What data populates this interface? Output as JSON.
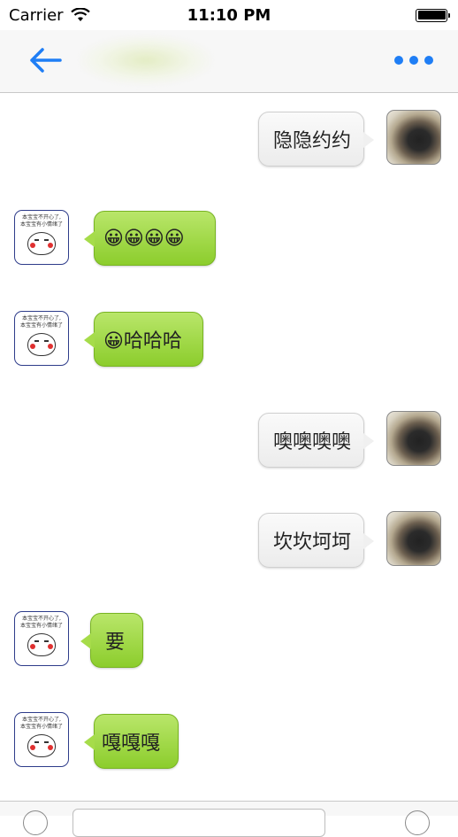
{
  "status_bar": {
    "carrier": "Carrier",
    "time": "11:10 PM"
  },
  "nav": {
    "back_icon": "back-arrow-icon",
    "more_icon": "more-dots-icon",
    "accent_color": "#1f7ef5"
  },
  "messages": [
    {
      "sender": "me",
      "text": "隐隐约约"
    },
    {
      "sender": "other",
      "text": "😀😀😀😀"
    },
    {
      "sender": "other",
      "text": "😀哈哈哈"
    },
    {
      "sender": "me",
      "text": "噢噢噢噢"
    },
    {
      "sender": "me",
      "text": "坎坎坷坷"
    },
    {
      "sender": "other",
      "text": "要"
    },
    {
      "sender": "other",
      "text": "嘎嘎嘎"
    }
  ],
  "avatars": {
    "other_caption_line1": "本宝宝不开心了,",
    "other_caption_line2": "本宝宝有小情绪了"
  },
  "colors": {
    "other_bubble": "#9ad43e",
    "my_bubble": "#f2f2f2"
  }
}
